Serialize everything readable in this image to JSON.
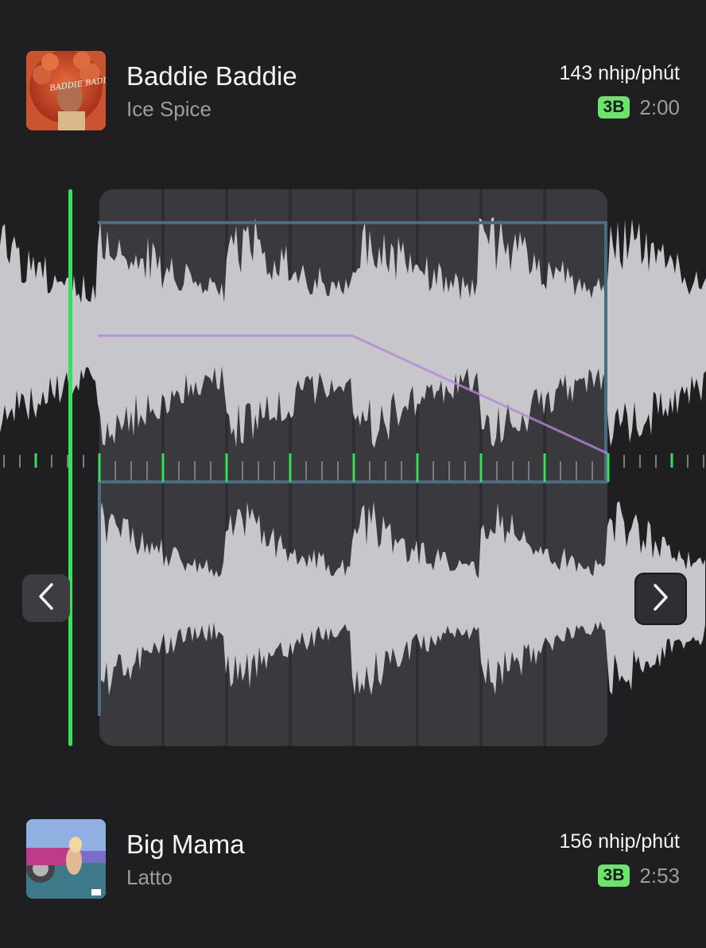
{
  "tracks": {
    "current": {
      "title": "Baddie Baddie",
      "artist": "Ice Spice",
      "bpm": "143 nhịp/phút",
      "key": "3B",
      "duration": "2:00",
      "artwork_text": "BADDIE BADDIE"
    },
    "next": {
      "title": "Big Mama",
      "artist": "Latto",
      "bpm": "156 nhịp/phút",
      "key": "3B",
      "duration": "2:53"
    }
  },
  "icons": {
    "prev": "chevron-left-icon",
    "next": "chevron-right-icon"
  },
  "colors": {
    "background": "#1f1e21",
    "key_badge": "#6be46b",
    "playhead": "#35e05a",
    "beat_marker": "#35e05a",
    "transition_outline": "#4a6b80",
    "volume_curve": "#b685d8",
    "waveform": "#c7c6cb"
  }
}
